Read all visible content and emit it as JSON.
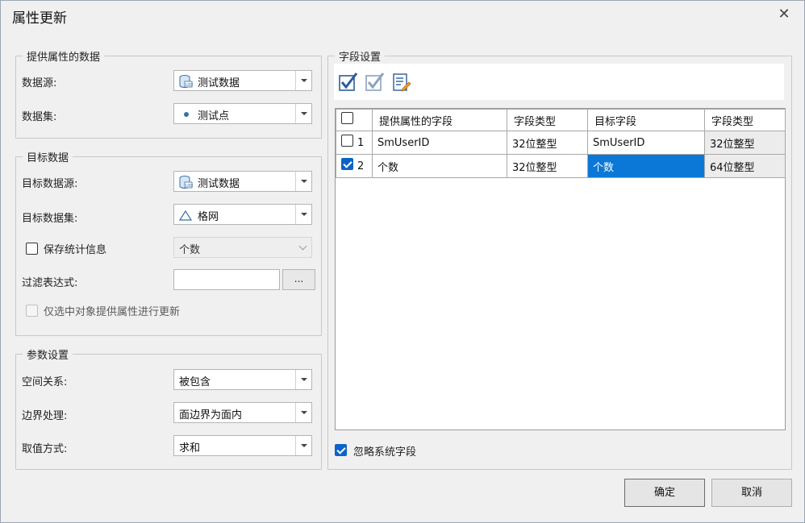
{
  "dialog": {
    "title": "属性更新",
    "close_symbol": "✕"
  },
  "source": {
    "legend": "提供属性的数据",
    "datasource_label": "数据源:",
    "datasource_value": "测试数据",
    "dataset_label": "数据集:",
    "dataset_value": "测试点"
  },
  "target": {
    "legend": "目标数据",
    "datasource_label": "目标数据源:",
    "datasource_value": "测试数据",
    "dataset_label": "目标数据集:",
    "dataset_value": "格网",
    "save_stats_label": "保存统计信息",
    "save_stats_checked": false,
    "stats_value": "个数",
    "filter_label": "过滤表达式:",
    "filter_value": "",
    "filter_button": "...",
    "selected_only_label": "仅选中对象提供属性进行更新",
    "selected_only_checked": false
  },
  "params": {
    "legend": "参数设置",
    "spatial_label": "空间关系:",
    "spatial_value": "被包含",
    "boundary_label": "边界处理:",
    "boundary_value": "面边界为面内",
    "value_label": "取值方式:",
    "value_value": "求和"
  },
  "fields": {
    "legend": "字段设置",
    "toolbar": [
      "select-all-icon",
      "select-inverse-icon",
      "field-list-edit-icon"
    ],
    "columns": [
      "提供属性的字段",
      "字段类型",
      "目标字段",
      "字段类型"
    ],
    "rows": [
      {
        "index": "1",
        "checked": false,
        "source_field": "SmUserID",
        "source_type": "32位整型",
        "target_field": "SmUserID",
        "target_type": "32位整型"
      },
      {
        "index": "2",
        "checked": true,
        "source_field": "个数",
        "source_type": "32位整型",
        "target_field": "个数",
        "target_type": "64位整型"
      }
    ],
    "ignore_system_label": "忽略系统字段",
    "ignore_system_checked": true
  },
  "buttons": {
    "ok": "确定",
    "cancel": "取消"
  },
  "colors": {
    "accent": "#0b64c5",
    "selection": "#0b78d7"
  }
}
